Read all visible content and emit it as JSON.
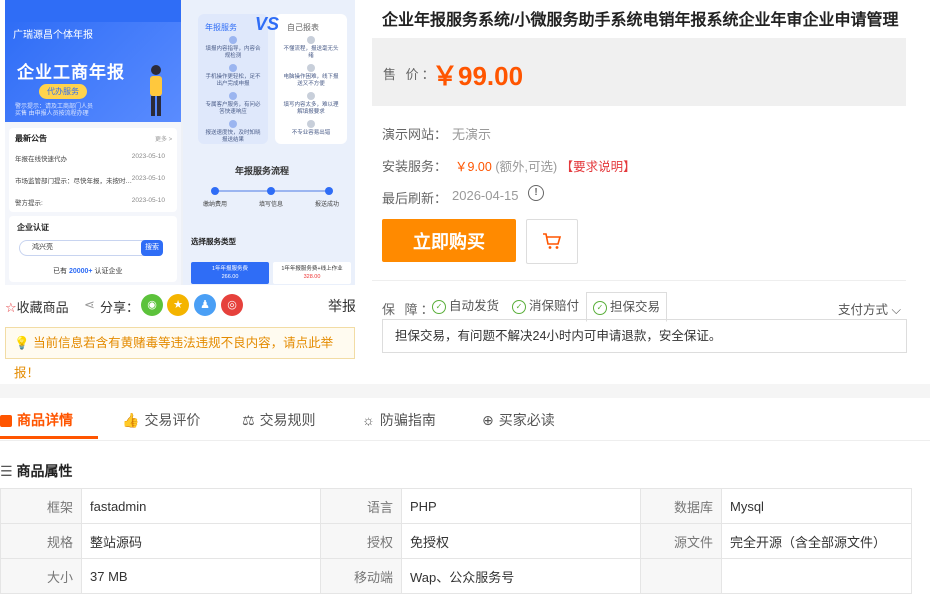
{
  "product": {
    "title": "企业年报服务系统/小微服务助手系统电销年报系统企业年审企业申请管理",
    "price_label": "售 价：",
    "price": "￥99.00",
    "demo_label": "演示网站：",
    "demo_value": "无演示",
    "install_label": "安装服务：",
    "install_price": "￥9.00",
    "install_note": "(额外,可选)",
    "install_req": "【要求说明】",
    "refresh_label": "最后刷新：",
    "refresh_value": "2026-04-15",
    "buy_label": "立即购买"
  },
  "guarantee": {
    "label": "保 障：",
    "items": [
      "自动发货",
      "消保赔付",
      "担保交易"
    ],
    "pay_label": "支付方式",
    "desc": "担保交易，有问题不解决24小时内可申请退款，安全保证。"
  },
  "share": {
    "fav_label": "收藏商品",
    "share_label": "分享：",
    "report_label": "举报"
  },
  "warning": "当前信息若含有黄赌毒等违法违规不良内容，请点此举报！",
  "tabs": [
    "商品详情",
    "交易评价",
    "交易规则",
    "防骗指南",
    "买家必读"
  ],
  "attributes": {
    "heading": "商品属性",
    "rows": [
      [
        [
          "框架",
          "fastadmin"
        ],
        [
          "语言",
          "PHP"
        ],
        [
          "数据库",
          "Mysql"
        ]
      ],
      [
        [
          "规格",
          "整站源码"
        ],
        [
          "授权",
          "免授权"
        ],
        [
          "源文件",
          "完全开源（含全部源文件）"
        ]
      ],
      [
        [
          "大小",
          "37 MB"
        ],
        [
          "移动端",
          "Wap、公众服务号"
        ]
      ]
    ]
  },
  "preview": {
    "left": {
      "header": "广瑞源昌个体年报",
      "banner_title": "企业工商年报",
      "banner_pill": "代办服务",
      "banner_small": "警示提示：请及工商部门人员买售 由申报人员按流程办理",
      "notice_title": "最新公告",
      "notice_more": "更多 >",
      "notices": [
        {
          "text": "年报在线快速代办",
          "date": "2023-05-10"
        },
        {
          "text": "市场监管部门提示：尽快年报，未按时…",
          "date": "2023-05-10"
        },
        {
          "text": "警方提示:",
          "date": "2023-05-10"
        }
      ],
      "auth_title": "企业认证",
      "auth_input": "鸿兴亮",
      "auth_button": "搜索",
      "auth_count_pre": "已有",
      "auth_count": "20000+",
      "auth_count_post": "认证企业"
    },
    "right": {
      "vs": "VS",
      "left_label": "年报服务",
      "right_label": "自己报表",
      "left_items": [
        "填报内容指导，内容合规检测",
        "手机操作更轻松，足不出户完成申报",
        "专属客户服务，有问必答快速响应",
        "报送速度快，及时知晓报送结果"
      ],
      "right_items": [
        "不懂流程，报送毫无头绪",
        "电脑操作困难，线下报送又不方便",
        "填写内容太多，难以理解填报要求",
        "不专业容易出错"
      ],
      "flow_title": "年报服务流程",
      "flow_steps": [
        "缴纳费用",
        "填写信息",
        "报送成功"
      ],
      "select_title": "选择服务类型",
      "pkg1": [
        "1年年报服务费",
        "266.00"
      ],
      "pkg2": [
        "1年年报服务费+线上作业",
        "328.00"
      ]
    }
  }
}
